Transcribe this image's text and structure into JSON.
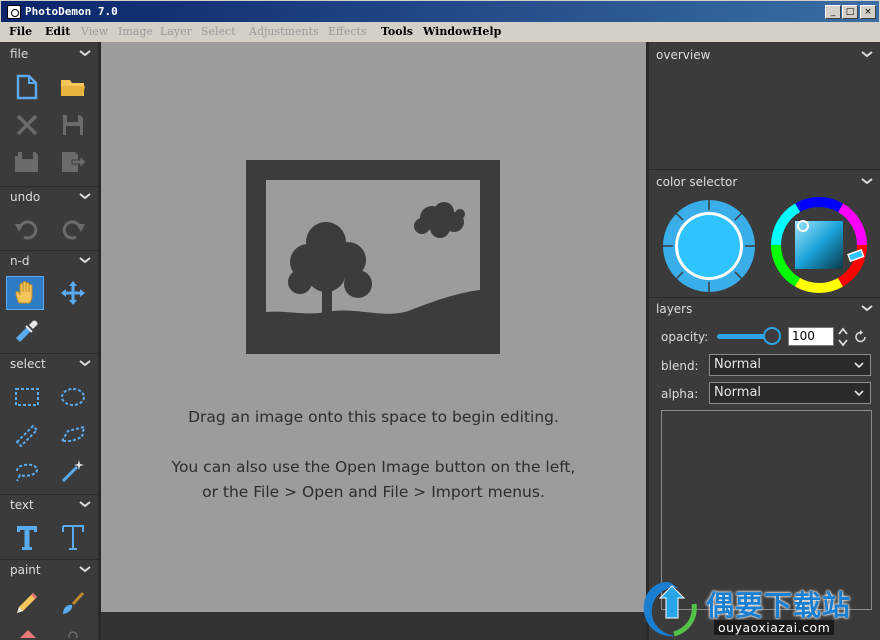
{
  "window": {
    "title": "PhotoDemon 7.0",
    "minimize": "_",
    "maximize": "□",
    "close": "×"
  },
  "menu": [
    {
      "label": "File",
      "enabled": true
    },
    {
      "label": "Edit",
      "enabled": true
    },
    {
      "label": "View",
      "enabled": false
    },
    {
      "label": "Image",
      "enabled": false
    },
    {
      "label": "Layer",
      "enabled": false
    },
    {
      "label": "Select",
      "enabled": false
    },
    {
      "label": "Adjustments",
      "enabled": false
    },
    {
      "label": "Effects",
      "enabled": false
    },
    {
      "label": "Tools",
      "enabled": true
    },
    {
      "label": "Window",
      "enabled": true
    },
    {
      "label": "Help",
      "enabled": true
    }
  ],
  "toolbox": {
    "sections": {
      "file": "file",
      "undo": "undo",
      "nd": "n-d",
      "select": "select",
      "text": "text",
      "paint": "paint"
    },
    "tools": {
      "new": "new-file-icon",
      "open": "open-folder-icon",
      "close": "close-icon",
      "save": "save-icon",
      "save_as": "save-as-icon",
      "export": "export-icon",
      "undo": "undo-icon",
      "redo": "redo-icon",
      "hand": "hand-icon",
      "move": "move-icon",
      "eyedropper": "eyedropper-icon",
      "rect_select": "rectangle-select-icon",
      "ellipse_select": "ellipse-select-icon",
      "line_select": "line-select-icon",
      "polygon_select": "polygon-select-icon",
      "lasso_select": "lasso-select-icon",
      "wand_select": "magic-wand-icon",
      "basic_text": "basic-text-icon",
      "typography": "typography-text-icon",
      "pencil": "pencil-icon",
      "brush": "brush-icon"
    },
    "active_tool": "hand"
  },
  "canvas": {
    "message_line1": "Drag an image onto this space to begin editing.",
    "message_line2": "You can also use the Open Image button on the left,",
    "message_line3": "or the File > Open and File > Import menus."
  },
  "right_panel": {
    "overview": "overview",
    "color_selector": "color selector",
    "layers": "layers",
    "opacity_label": "opacity:",
    "opacity_value": "100",
    "blend_label": "blend:",
    "blend_value": "Normal",
    "alpha_label": "alpha:",
    "alpha_value": "Normal",
    "primary_color": "#2fc3ff"
  },
  "watermark": {
    "text": "偶要下载站",
    "url": "ouyaoxiazai.com"
  },
  "colors": {
    "accent": "#2e7cc4",
    "icon_blue": "#5aaaf0",
    "folder_yellow": "#f5c65a",
    "panel_bg": "#3b3b3b",
    "canvas_bg": "#9c9c9c"
  }
}
